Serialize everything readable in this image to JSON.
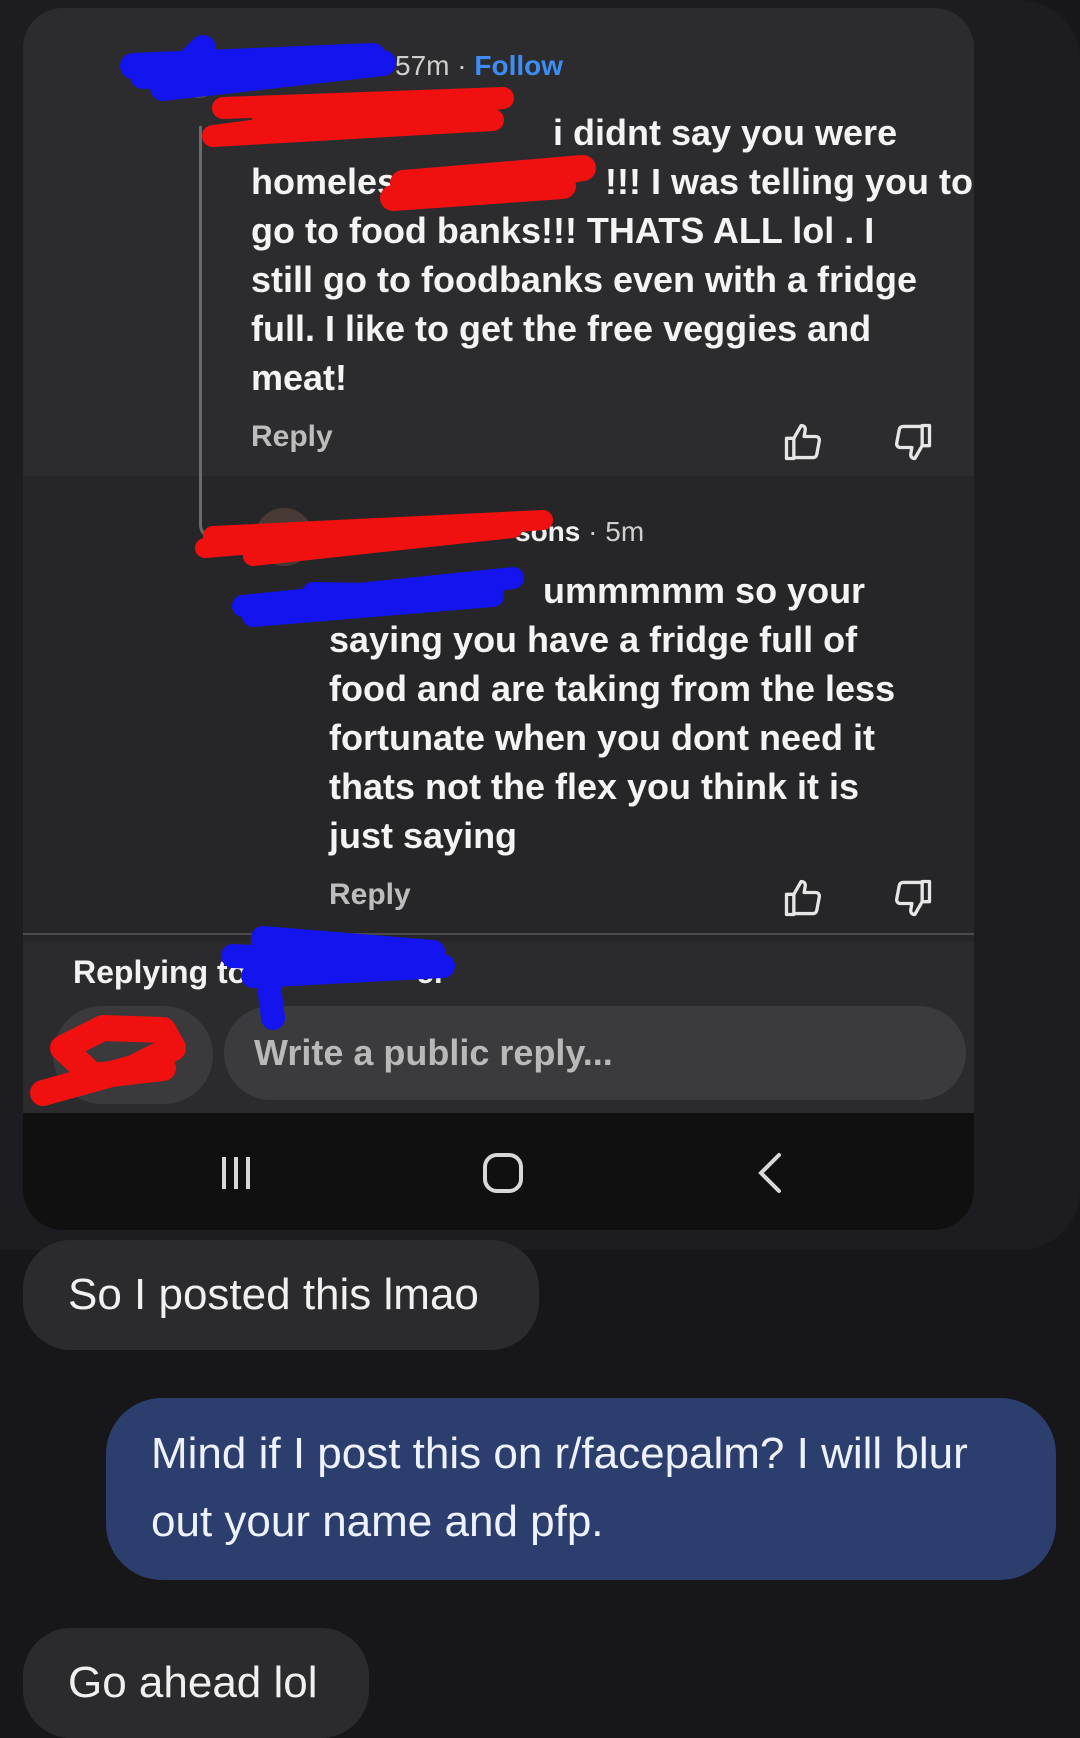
{
  "comment1": {
    "time": "57m",
    "separator": "·",
    "follow_label": "Follow",
    "text_lines": [
      "i didnt say you were",
      "homeless",
      "!!! I was telling you to",
      "go to food banks!!! THATS ALL lol . I",
      "still go to foodbanks even with a fridge",
      "full. I like to get the free veggies and",
      "meat!"
    ],
    "reply_label": "Reply"
  },
  "comment2": {
    "author_fragment": "sons",
    "time": "5m",
    "separator": "·",
    "text_lines": [
      "ummmmm so your",
      "saying you have a fridge full of",
      "food and are taking from the less",
      "fortunate when you dont need it",
      "thats not the flex you think it is",
      "just saying"
    ],
    "reply_label": "Reply"
  },
  "reply_bar": {
    "replying_to_label": "Replying to",
    "cancel_label": "el",
    "input_placeholder": "Write a public reply..."
  },
  "messages": [
    {
      "side": "incoming",
      "text": "So I posted this lmao"
    },
    {
      "side": "outgoing",
      "text_lines": [
        "Mind if I post this on r/facepalm? I will blur",
        "out your name and pfp."
      ]
    },
    {
      "side": "incoming",
      "text": "Go ahead lol"
    }
  ],
  "colors": {
    "follow_blue": "#3e8cf5",
    "outgoing_bubble": "#2c3e6e",
    "redaction_red": "#f01010",
    "redaction_blue": "#1010f0"
  }
}
